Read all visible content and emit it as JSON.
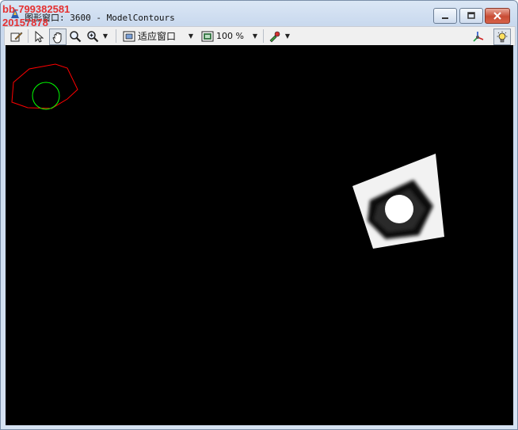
{
  "window": {
    "title": "图形窗口: 3600 - ModelContours",
    "controls": [
      "minimize",
      "maximize",
      "close"
    ]
  },
  "watermark": {
    "line1": "bb-799382581",
    "line2": "20157878"
  },
  "toolbar": {
    "zoom_mode": "适应窗口",
    "zoom_percent": "100 %",
    "icons": [
      "edit-icon",
      "pointer-icon",
      "hand-pan-icon",
      "magnify-icon",
      "zoom-in-icon",
      "fit-window-icon",
      "zoom-percent-icon",
      "color-picker-icon",
      "axes-3d-icon",
      "lightbulb-icon"
    ]
  },
  "colors": {
    "canvas_background": "#000000",
    "model_contour": "#ff0000",
    "inner_circle": "#00ff00"
  }
}
